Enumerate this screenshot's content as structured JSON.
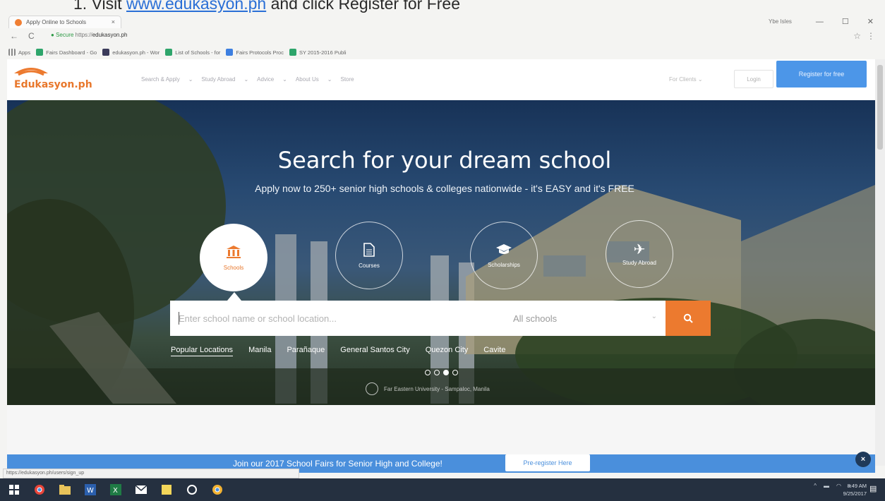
{
  "doc": {
    "step_prefix": "1.   Visit ",
    "step_link": "www.edukasyon.ph",
    "step_suffix": " and click Register for Free"
  },
  "browser": {
    "tab_title": "Apply Online to Schools",
    "tab_close": "×",
    "user_name": "Ybe Isles",
    "ctrl_min": "—",
    "ctrl_max": "☐",
    "ctrl_close": "✕",
    "secure_label": "Secure",
    "url_prefix": "https://",
    "url_host": "edukasyon.ph",
    "bookmarks": [
      {
        "label": "Apps",
        "icon": "apps-grid-icon"
      },
      {
        "label": "Fairs Dashboard - Go",
        "icon": "sheets-icon"
      },
      {
        "label": "edukasyon.ph - Wor",
        "icon": "site-icon"
      },
      {
        "label": "List of Schools - for",
        "icon": "sheets-icon"
      },
      {
        "label": "Fairs Protocols Proc",
        "icon": "docs-icon"
      },
      {
        "label": "SY 2015-2016 Publi",
        "icon": "sheets-icon"
      }
    ]
  },
  "site": {
    "logo_text": "Edukasyon.ph",
    "nav": [
      "Search & Apply",
      "Study Abroad",
      "Advice",
      "About Us",
      "Store"
    ],
    "for_clients": "For Clients",
    "login": "Login",
    "register": "Register for free"
  },
  "hero": {
    "title": "Search for your dream school",
    "subtitle": "Apply now to 250+ senior high schools & colleges nationwide - it's EASY and it's FREE",
    "categories": [
      {
        "label": "Schools",
        "icon": "institution-icon"
      },
      {
        "label": "Courses",
        "icon": "document-icon"
      },
      {
        "label": "Scholarships",
        "icon": "graduation-cap-icon"
      },
      {
        "label": "Study Abroad",
        "icon": "airplane-icon"
      }
    ],
    "search_placeholder": "Enter school name or school location...",
    "select_value": "All schools",
    "popular_label": "Popular Locations",
    "locations": [
      "Manila",
      "Parañaque",
      "General Santos City",
      "Quezon City",
      "Cavite"
    ],
    "caption": "Far Eastern University - Sampaloc, Manila"
  },
  "promo": {
    "text": "Join our 2017 School Fairs for Senior High and College!",
    "button": "Pre-register Here",
    "close": "×"
  },
  "status_url": "https://edukasyon.ph/users/sign_up",
  "taskbar": {
    "time": "8:49 AM",
    "date": "9/25/2017"
  },
  "colors": {
    "brand_orange": "#ec7a2f",
    "brand_blue": "#4c96e8"
  }
}
